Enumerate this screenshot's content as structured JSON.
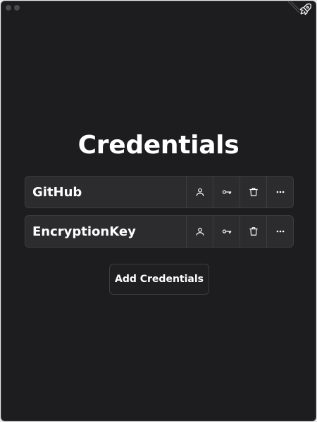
{
  "window": {
    "traffic_lights": [
      "window-close-dot",
      "window-minimize-dot"
    ]
  },
  "toolbar": {
    "icons": [
      "rocket-icon"
    ]
  },
  "page": {
    "title": "Credentials"
  },
  "credentials": [
    {
      "name": "GitHub",
      "actions": [
        "user-icon",
        "key-icon",
        "trash-icon",
        "more-icon"
      ]
    },
    {
      "name": "EncryptionKey",
      "actions": [
        "user-icon",
        "key-icon",
        "trash-icon",
        "more-icon"
      ]
    }
  ],
  "add_button": {
    "label": "Add Credentials"
  },
  "colors": {
    "background": "#1d1d1f",
    "row_background": "#2c2c2e",
    "border": "#3d3d40",
    "text": "#ffffff"
  }
}
